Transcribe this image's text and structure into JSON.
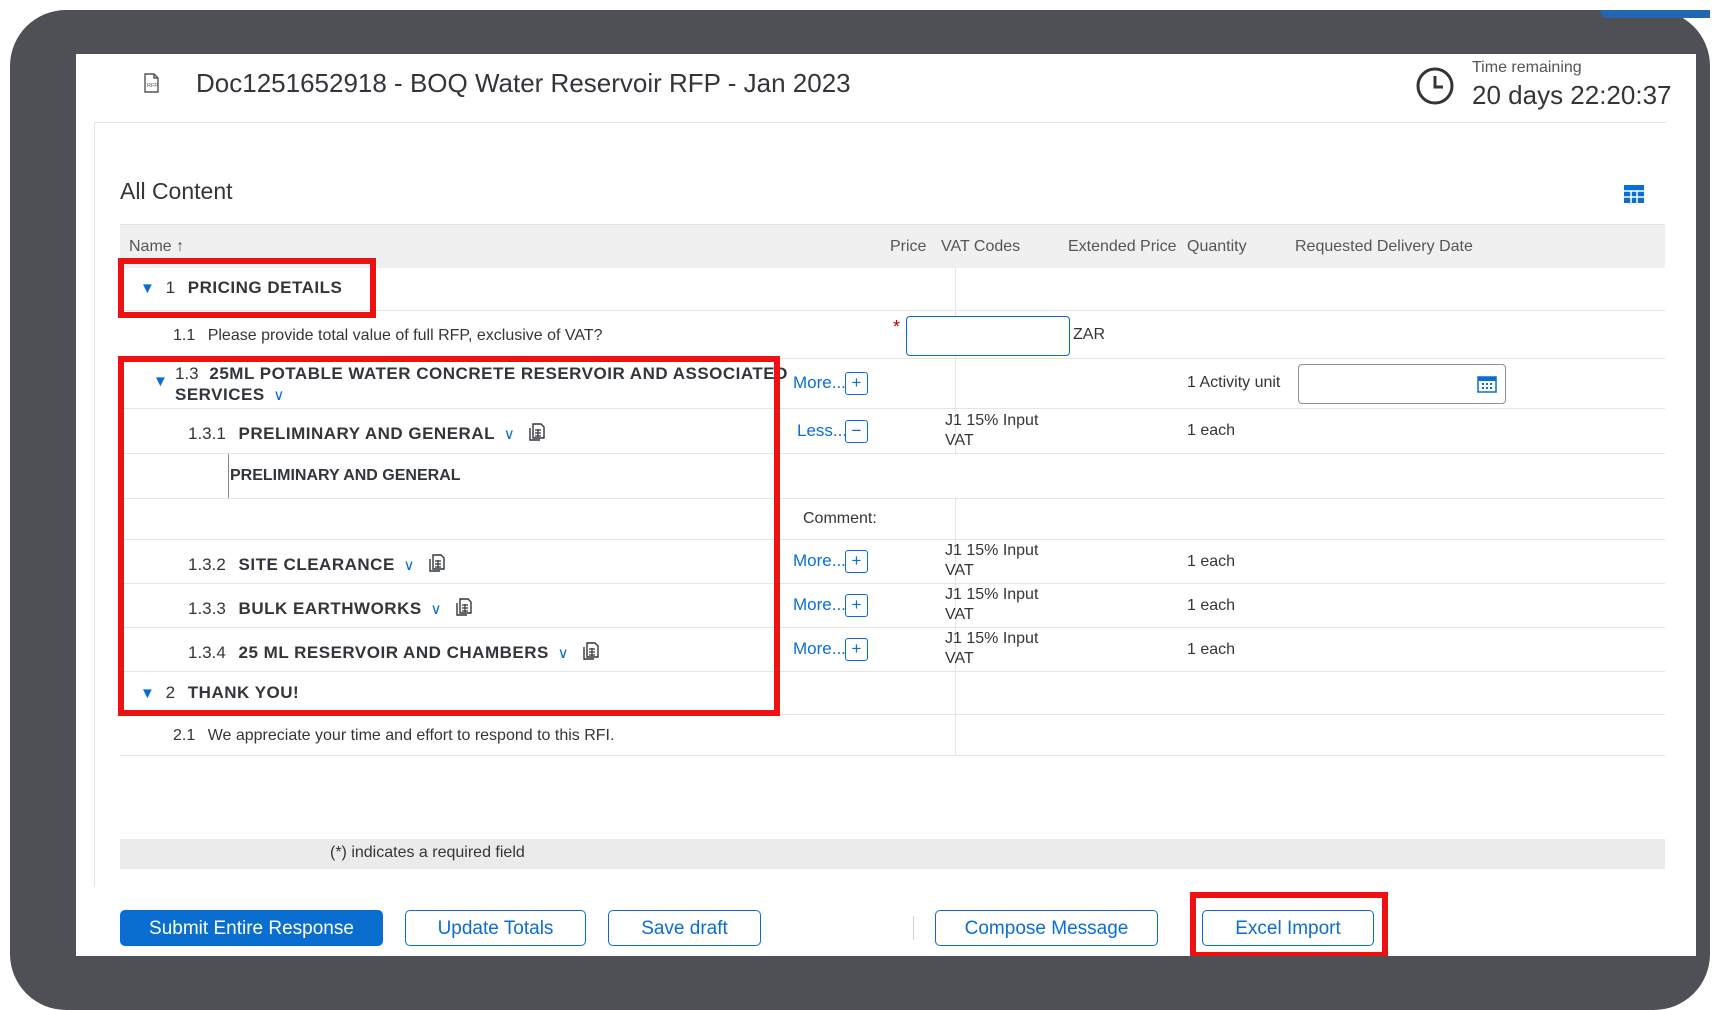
{
  "header": {
    "doc_icon_label": "RFP",
    "title": "Doc1251652918 - BOQ Water Reservoir RFP - Jan 2023",
    "time_label": "Time remaining",
    "time_value": "20 days 22:20:37"
  },
  "section_title": "All Content",
  "table": {
    "headers": {
      "name": "Name ↑",
      "price": "Price",
      "vat_codes": "VAT Codes",
      "extended_price": "Extended Price",
      "quantity": "Quantity",
      "delivery_date": "Requested Delivery Date"
    },
    "rows": {
      "r1": {
        "caret": "▼",
        "num": "1",
        "label": "PRICING DETAILS"
      },
      "r1_1": {
        "num": "1.1",
        "label": "Please provide total value of full RFP, exclusive of VAT?",
        "required": "*",
        "currency": "ZAR"
      },
      "r1_3": {
        "caret": "▼",
        "num": "1.3",
        "label_line1": "25ML POTABLE WATER CONCRETE RESERVOIR AND ASSOCIATED",
        "label_line2": "SERVICES",
        "link": "More...",
        "btn": "+",
        "quantity": "1 Activity unit"
      },
      "r1_3_1": {
        "num": "1.3.1",
        "label": "PRELIMINARY AND GENERAL",
        "link": "Less...",
        "btn": "−",
        "vat_line1": "J1 15% Input",
        "vat_line2": "VAT",
        "quantity": "1 each"
      },
      "r1_3_1_desc": {
        "text": "PRELIMINARY AND GENERAL"
      },
      "comment": {
        "label": "Comment:"
      },
      "r1_3_2": {
        "num": "1.3.2",
        "label": "SITE CLEARANCE",
        "link": "More...",
        "btn": "+",
        "vat_line1": "J1 15% Input",
        "vat_line2": "VAT",
        "quantity": "1 each"
      },
      "r1_3_3": {
        "num": "1.3.3",
        "label": "BULK EARTHWORKS",
        "link": "More...",
        "btn": "+",
        "vat_line1": "J1 15% Input",
        "vat_line2": "VAT",
        "quantity": "1 each"
      },
      "r1_3_4": {
        "num": "1.3.4",
        "label": "25 ML RESERVOIR AND CHAMBERS",
        "link": "More...",
        "btn": "+",
        "vat_line1": "J1 15% Input",
        "vat_line2": "VAT",
        "quantity": "1 each"
      },
      "r2": {
        "caret": "▼",
        "num": "2",
        "label": "THANK YOU!"
      },
      "r2_1": {
        "num": "2.1",
        "label": "We appreciate your time and effort to respond to this RFI."
      }
    }
  },
  "footer_note": "(*) indicates a required field",
  "buttons": {
    "submit": "Submit Entire Response",
    "update": "Update Totals",
    "save": "Save draft",
    "compose": "Compose Message",
    "excel": "Excel Import"
  },
  "colors": {
    "accent": "#0a6ed1",
    "highlight": "#ee1111",
    "frame": "#4e5055"
  }
}
